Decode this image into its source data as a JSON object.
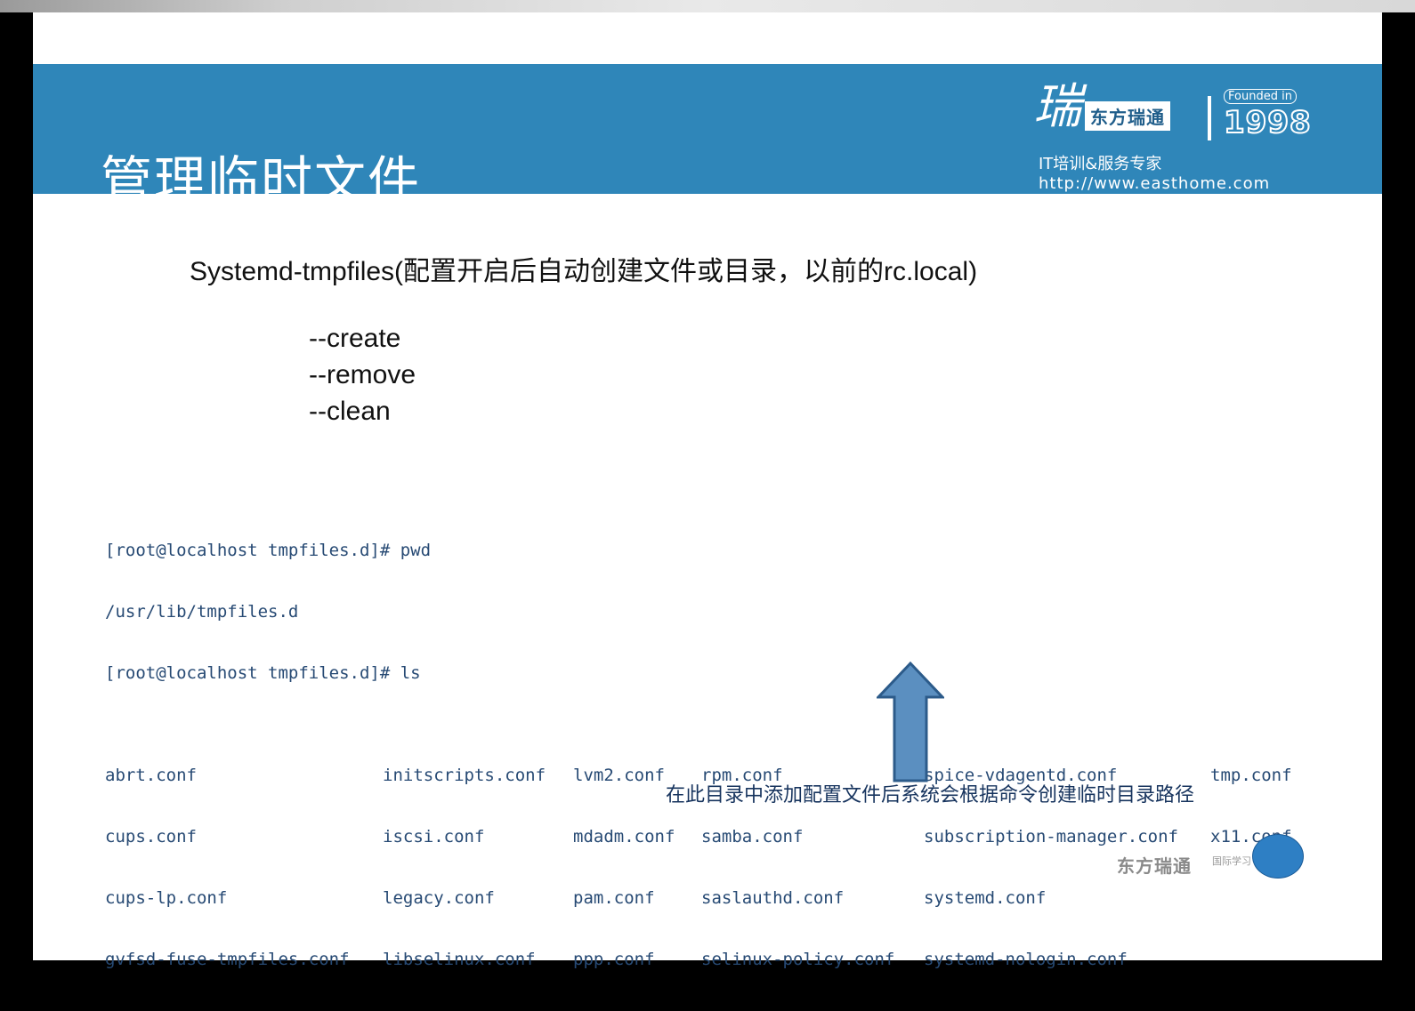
{
  "slide": {
    "title": "管理临时文件",
    "logo": {
      "name": "东方瑞通",
      "founded_label": "Founded in",
      "year": "1998",
      "slogan": "IT培训&服务专家",
      "url": "http://www.easthome.com"
    },
    "headline": "Systemd-tmpfiles(配置开启后自动创建文件或目录，以前的rc.local)",
    "options": [
      "--create",
      "--remove",
      "--clean"
    ],
    "terminal": {
      "lines": [
        "[root@localhost tmpfiles.d]# pwd",
        "/usr/lib/tmpfiles.d",
        "[root@localhost tmpfiles.d]# ls"
      ],
      "ls_columns": [
        [
          "abrt.conf",
          "cups.conf",
          "cups-lp.conf",
          "gvfsd-fuse-tmpfiles.conf"
        ],
        [
          "initscripts.conf",
          "iscsi.conf",
          "legacy.conf",
          "libselinux.conf"
        ],
        [
          "lvm2.conf",
          "mdadm.conf",
          "pam.conf",
          "ppp.conf"
        ],
        [
          "rpm.conf",
          "samba.conf",
          "saslauthd.conf",
          "selinux-policy.conf"
        ],
        [
          "spice-vdagentd.conf",
          "subscription-manager.conf",
          "systemd.conf",
          "systemd-nologin.conf"
        ],
        [
          "tmp.conf",
          "x11.conf"
        ]
      ]
    },
    "note": "在此目录中添加配置文件后系统会根据命令创建临时目录路径",
    "footer_logo": "东方瑞通",
    "footer_sub": "国际学习"
  },
  "colors": {
    "banner": "#2f86b9",
    "terminal_text": "#274a74",
    "arrow_fill": "#5b8fc0"
  }
}
